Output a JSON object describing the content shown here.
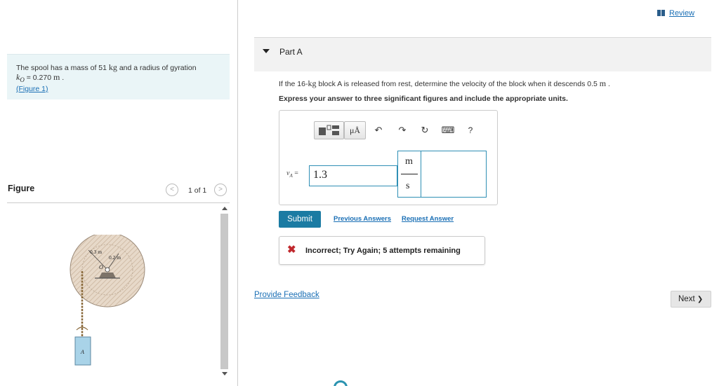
{
  "problem": {
    "text_prefix": "The spool has a mass of 51",
    "mass_unit": "kg",
    "text_mid": "and a radius of gyration",
    "k_symbol": "k",
    "k_sub": "O",
    "k_value": "= 0.270",
    "k_unit": "m",
    "figure_link": "(Figure 1)"
  },
  "figure": {
    "title": "Figure",
    "page_count": "1 of 1",
    "prev_symbol": "<",
    "next_symbol": ">",
    "labels": {
      "outer_r": "0.3 m",
      "inner_r": "0.2 m",
      "center": "O",
      "block": "A"
    }
  },
  "review": {
    "label": "Review",
    "icon": "bookmark-bars-icon"
  },
  "part": {
    "label": "Part A"
  },
  "question": {
    "text": "If the 16-",
    "mass_unit": "kg",
    "text2": "block A is released from rest, determine the velocity of the block when it descends 0.5",
    "dist_unit": "m",
    "tail": "."
  },
  "instruction": "Express your answer to three significant figures and include the appropriate units.",
  "toolbar": {
    "units_label": "μÅ",
    "undo_icon": "↶",
    "redo_icon": "↷",
    "reset_icon": "↻",
    "keyboard_icon": "⌨",
    "help_label": "?"
  },
  "answer": {
    "var_symbol": "v",
    "var_sub": "A",
    "equals": "=",
    "value": "1.3",
    "unit_numerator": "m",
    "unit_denominator": "s"
  },
  "actions": {
    "submit": "Submit",
    "previous_answers": "Previous Answers",
    "request_answer": "Request Answer"
  },
  "feedback": {
    "icon": "✖",
    "message": "Incorrect; Try Again; 5 attempts remaining"
  },
  "footer": {
    "provide_feedback": "Provide Feedback",
    "next": "Next",
    "next_icon": "❯"
  },
  "colors": {
    "accent": "#1b7ba3",
    "link": "#1a6fb5",
    "error": "#c0282d",
    "problem_bg": "#eaf5f7"
  }
}
